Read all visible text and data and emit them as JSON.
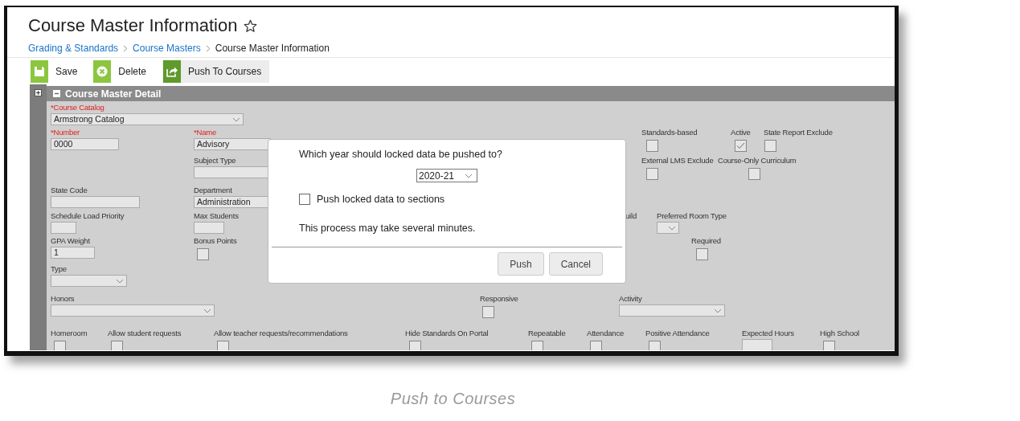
{
  "page_title": "Course Master Information",
  "breadcrumb": [
    {
      "label": "Grading & Standards",
      "kind": "link"
    },
    {
      "label": "Course Masters",
      "kind": "link"
    },
    {
      "label": "Course Master Information",
      "kind": "current"
    }
  ],
  "toolbar": [
    {
      "label": "Save",
      "selected": false
    },
    {
      "label": "Delete",
      "selected": false
    },
    {
      "label": "Push To Courses",
      "selected": true
    }
  ],
  "panel": {
    "title": "Course Master Detail",
    "expanded": true
  },
  "form_rows": [
    {
      "fields": [
        {
          "kind": "select",
          "label": "*Course Catalog",
          "required": true,
          "value": "Armstrong Catalog"
        }
      ]
    },
    {
      "fields": [
        {
          "kind": "text",
          "label": "*Number",
          "required": true,
          "value": "0000"
        },
        {
          "kind": "text",
          "label": "*Name",
          "required": true,
          "value": "Advisory"
        },
        {
          "kind": "checkbox",
          "label": "Standards-based",
          "checked": false
        },
        {
          "kind": "checkbox",
          "label": "Active",
          "checked": true
        },
        {
          "kind": "checkbox",
          "label": "State Report Exclude",
          "checked": false
        }
      ]
    },
    {
      "fields": [
        {
          "kind": "text",
          "label": "Subject Type"
        },
        {
          "kind": "checkbox",
          "label": "External LMS Exclude",
          "checked": false
        },
        {
          "kind": "checkbox",
          "label": "Course-Only Curriculum",
          "checked": false
        }
      ]
    },
    {
      "fields": [
        {
          "kind": "text",
          "label": "State Code"
        },
        {
          "kind": "text",
          "label": "Department",
          "value": "Administration"
        }
      ]
    },
    {
      "fields": [
        {
          "kind": "text",
          "label": "Schedule Load Priority"
        },
        {
          "kind": "text",
          "label": "Max Students"
        },
        {
          "kind": "label",
          "label": "uild"
        },
        {
          "kind": "select",
          "label": "Preferred Room Type"
        }
      ]
    },
    {
      "fields": [
        {
          "kind": "text",
          "label": "GPA Weight",
          "value": "1"
        },
        {
          "kind": "checkbox",
          "label": "Bonus Points",
          "checked": false
        },
        {
          "kind": "checkbox",
          "label": "Required",
          "checked": false
        }
      ]
    },
    {
      "fields": [
        {
          "kind": "select",
          "label": "Type"
        }
      ]
    },
    {
      "fields": [
        {
          "kind": "select",
          "label": "Honors"
        },
        {
          "kind": "checkbox",
          "label": "Responsive",
          "checked": false
        },
        {
          "kind": "select",
          "label": "Activity"
        }
      ]
    },
    {
      "fields": [
        {
          "kind": "checkbox",
          "label": "Homeroom",
          "checked": false
        },
        {
          "kind": "checkbox",
          "label": "Allow student requests",
          "checked": false
        },
        {
          "kind": "checkbox",
          "label": "Allow teacher requests/recommendations",
          "checked": false
        },
        {
          "kind": "checkbox",
          "label": "Hide Standards On Portal",
          "checked": false
        },
        {
          "kind": "checkbox",
          "label": "Repeatable",
          "checked": false
        },
        {
          "kind": "checkbox",
          "label": "Attendance",
          "checked": false
        },
        {
          "kind": "checkbox",
          "label": "Positive Attendance",
          "checked": false
        },
        {
          "kind": "text",
          "label": "Expected Hours"
        },
        {
          "kind": "checkbox",
          "label": "High School",
          "checked": false
        }
      ]
    }
  ],
  "dialog": {
    "question": "Which year should locked data be pushed to?",
    "year": "2020-21",
    "option": {
      "label": "Push locked data to sections",
      "checked": false
    },
    "note": "This process may take several minutes.",
    "buttons": [
      "Push",
      "Cancel"
    ]
  },
  "caption": "Push to Courses"
}
